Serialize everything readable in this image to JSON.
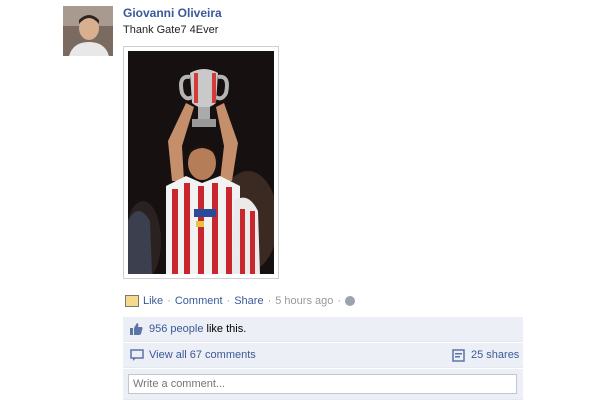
{
  "post": {
    "author": "Giovanni Oliveira",
    "message": "Thank Gate7 4Ever"
  },
  "actions": {
    "like": "Like",
    "comment": "Comment",
    "share": "Share",
    "sep": "·",
    "timestamp": "5 hours ago"
  },
  "ufi": {
    "likes_count": "956 people",
    "likes_suffix": "like this.",
    "view_comments": "View all 67 comments",
    "shares": "25 shares",
    "comment_placeholder": "Write a comment..."
  },
  "colors": {
    "link": "#3b5998",
    "ufi_background": "#eceff5"
  }
}
